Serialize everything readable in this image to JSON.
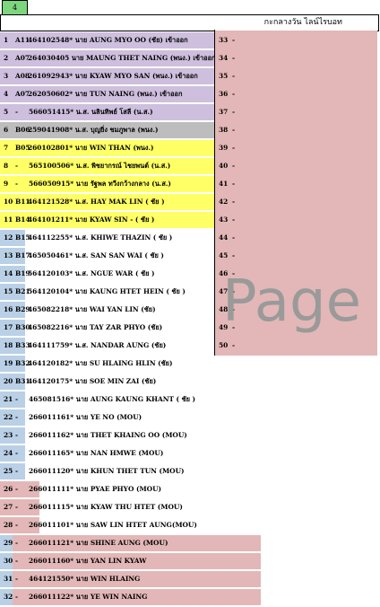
{
  "sheet_tab": "4",
  "title": "กะกลางวัน ไลน์ไรบอท",
  "watermark": "Page",
  "left_rows": [
    {
      "num": "1",
      "code": "A11",
      "text": "464102548* นาย AUNG MYO OO  (ชัย) เข้าออก",
      "bg": "#cdbfdd"
    },
    {
      "num": "2",
      "code": "A07",
      "text": "264030405 นาย MAUNG THET NAING (พนง.) เข้าออก",
      "bg": "#cdbfdd"
    },
    {
      "num": "3",
      "code": "A08",
      "text": "261092943* นาย KYAW MYO SAN (พนง.) เข้าออก",
      "bg": "#cdbfdd"
    },
    {
      "num": "4",
      "code": "A07",
      "text": "262050602* นาย TUN NAING (พนง.) เข้าออก",
      "bg": "#cdbfdd"
    },
    {
      "num": "5",
      "code": "-",
      "text": "566051415* น.ส. นลินทิพย์ โสลี (น.ส.)",
      "bg": "#cdbfdd"
    },
    {
      "num": "6",
      "code": "B06",
      "text": "259041908* น.ส. บุญยิ่ง ชมภูพาล (พนง.)",
      "bg": "#bdbdbd"
    },
    {
      "num": "7",
      "code": "B05",
      "text": "260102801* นาย WIN THAN   (พนง.)",
      "bg": "#ffff66"
    },
    {
      "num": "8",
      "code": "-",
      "text": "565100506* น.ส. พิชยากรณ์ ไชยพนต์ (น.ส.)",
      "bg": "#ffff66"
    },
    {
      "num": "9",
      "code": "-",
      "text": "566050915* นาย รัฐพล ทวีงกว้างกลาง (น.ส.)",
      "bg": "#ffff66"
    },
    {
      "num": "10",
      "code": "B11",
      "text": "464121528* น.ส. HAY MAK LIN ( ชัย )",
      "bg": "#ffff66"
    },
    {
      "num": "11",
      "code": "B14",
      "text": "464101211* นาย KYAW SIN  -  ( ชัย )",
      "bg": "#ffff66"
    },
    {
      "num": "12",
      "code": "B15",
      "text": "464112255* น.ส. KHIWE THAZIN  ( ชัย )",
      "bg": "#ffffff"
    },
    {
      "num": "13",
      "code": "B17",
      "text": "465050461* น.ส. SAN SAN WAI  ( ชัย )",
      "bg": "#ffffff"
    },
    {
      "num": "14",
      "code": "B19",
      "text": "564120103* น.ส. NGUE WAR  ( ชัย )",
      "bg": "#ffffff"
    },
    {
      "num": "15",
      "code": "B21",
      "text": "564120104* นาย KAUNG HTET HEIN  ( ชัย )",
      "bg": "#ffffff"
    },
    {
      "num": "16",
      "code": "B29",
      "text": "465082218* นาย WAI YAN LIN  (ชัย)",
      "bg": "#ffffff"
    },
    {
      "num": "17",
      "code": "B30",
      "text": "465082216* นาย TAY ZAR PHYO  (ชัย)",
      "bg": "#ffffff"
    },
    {
      "num": "18",
      "code": "B33",
      "text": "464111759* น.ส. NANDAR AUNG  (ชัย)",
      "bg": "#ffffff"
    },
    {
      "num": "19",
      "code": "B32",
      "text": "464120182* นาย SU HLAING HLIN  (ชัย)",
      "bg": "#ffffff"
    },
    {
      "num": "20",
      "code": "B31",
      "text": "464120175* นาย SOE MIN ZAI  (ชัย)",
      "bg": "#ffffff"
    },
    {
      "num": "21",
      "code": "-",
      "text": "465081516* นาย AUNG KAUNG KHANT ( ชัย )",
      "bg": "#ffffff"
    },
    {
      "num": "22",
      "code": "-",
      "text": "266011161* นาย YE NO  (MOU)",
      "bg": "#ffffff"
    },
    {
      "num": "23",
      "code": "-",
      "text": "266011162* นาย THET KHAING OO  (MOU)",
      "bg": "#ffffff"
    },
    {
      "num": "24",
      "code": "-",
      "text": "266011165* นาย NAN HMWE  (MOU)",
      "bg": "#ffffff"
    },
    {
      "num": "25",
      "code": "-",
      "text": "266011120* นาย KHUN THET TUN  (MOU)",
      "bg": "#ffffff"
    },
    {
      "num": "26",
      "code": "-",
      "text": "266011111* นาย PYAE PHYO  (MOU)",
      "bg": "#ffffff"
    },
    {
      "num": "27",
      "code": "-",
      "text": "266011115* นาย KYAW THU HTET  (MOU)",
      "bg": "#ffffff"
    },
    {
      "num": "28",
      "code": "-",
      "text": "266011101* นาย SAW LIN HTET AUNG(MOU)",
      "bg": "#ffffff"
    },
    {
      "num": "29",
      "code": "-",
      "text": "266011121* นาย SHINE AUNG  (MOU)",
      "bg": "#e3b7b7"
    },
    {
      "num": "30",
      "code": "-",
      "text": "266011160* นาย YAN LIN KYAW",
      "bg": "#e3b7b7"
    },
    {
      "num": "31",
      "code": "-",
      "text": "464121550* นาย WIN HLAING",
      "bg": "#e3b7b7"
    },
    {
      "num": "32",
      "code": "-",
      "text": "266011122* นาย YE WIN NAING",
      "bg": "#e3b7b7"
    }
  ],
  "right_rows": [
    {
      "num": "33",
      "dash": "-"
    },
    {
      "num": "34",
      "dash": "-"
    },
    {
      "num": "35",
      "dash": "-"
    },
    {
      "num": "36",
      "dash": "-"
    },
    {
      "num": "37",
      "dash": "-"
    },
    {
      "num": "38",
      "dash": "-"
    },
    {
      "num": "39",
      "dash": "-"
    },
    {
      "num": "40",
      "dash": "-"
    },
    {
      "num": "41",
      "dash": "-"
    },
    {
      "num": "42",
      "dash": "-"
    },
    {
      "num": "43",
      "dash": "-"
    },
    {
      "num": "44",
      "dash": "-"
    },
    {
      "num": "45",
      "dash": "-"
    },
    {
      "num": "46",
      "dash": "-"
    },
    {
      "num": "47",
      "dash": "-"
    },
    {
      "num": "48",
      "dash": "-"
    },
    {
      "num": "49",
      "dash": "-"
    },
    {
      "num": "50",
      "dash": "-"
    }
  ],
  "colors": {
    "right_bg": "#e3b7b7",
    "blue_strip": "#b9d0e6",
    "tab_green": "#7dd67d"
  }
}
